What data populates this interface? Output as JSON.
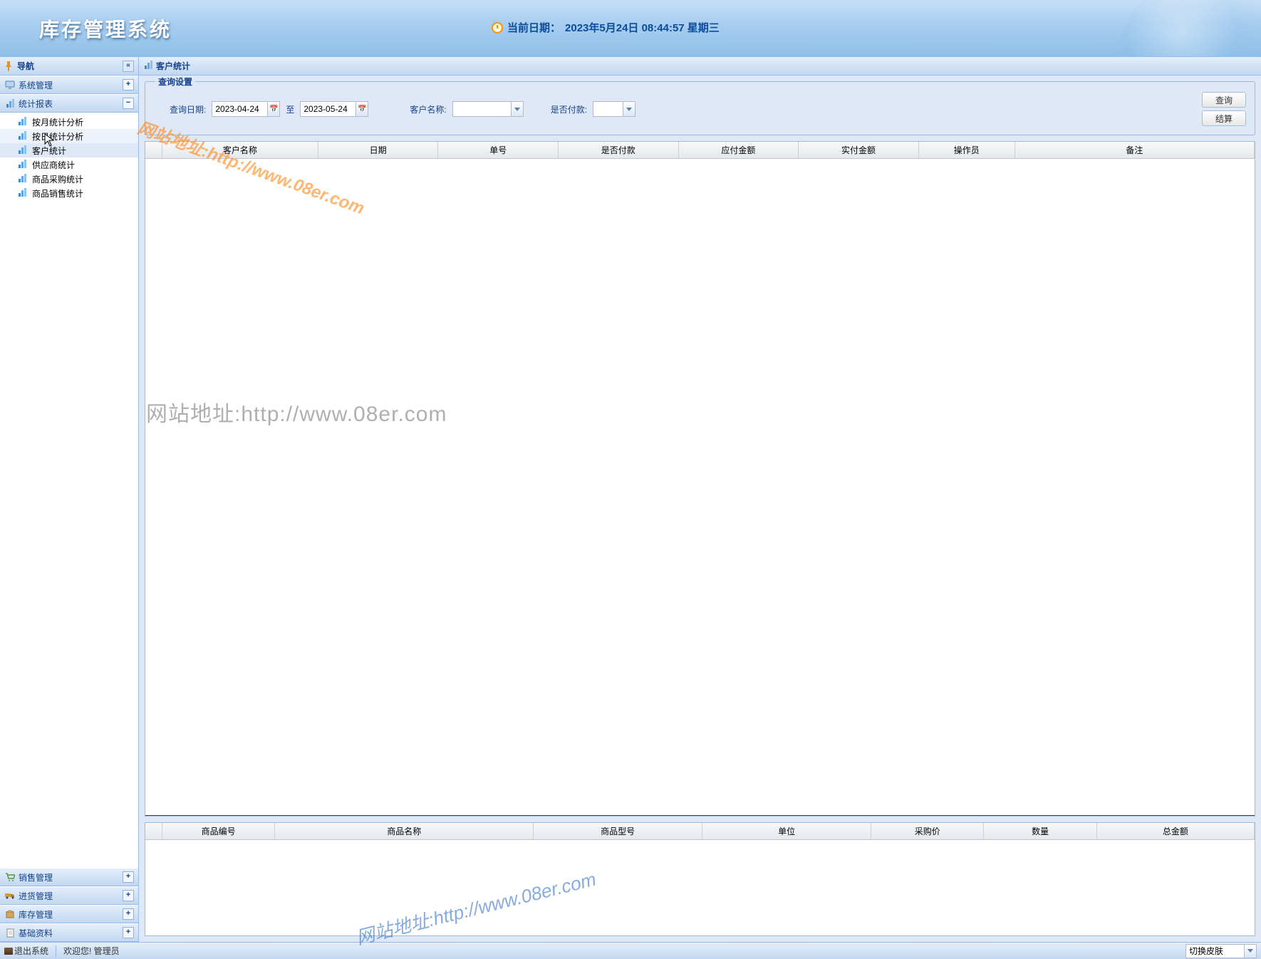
{
  "header": {
    "title": "库存管理系统",
    "date_label": "当前日期：",
    "date_value": "2023年5月24日 08:44:57 星期三"
  },
  "sidebar": {
    "nav_title": "导航",
    "sections": [
      {
        "label": "系统管理",
        "expanded": false,
        "icon": "monitor"
      },
      {
        "label": "统计报表",
        "expanded": true,
        "icon": "chart"
      },
      {
        "label": "销售管理",
        "expanded": false,
        "icon": "cart"
      },
      {
        "label": "进货管理",
        "expanded": false,
        "icon": "truck"
      },
      {
        "label": "库存管理",
        "expanded": false,
        "icon": "box"
      },
      {
        "label": "基础资料",
        "expanded": false,
        "icon": "doc"
      }
    ],
    "tree": [
      {
        "label": "按月统计分析"
      },
      {
        "label": "按日统计分析"
      },
      {
        "label": "客户统计"
      },
      {
        "label": "供应商统计"
      },
      {
        "label": "商品采购统计"
      },
      {
        "label": "商品销售统计"
      }
    ]
  },
  "tab": {
    "title": "客户统计"
  },
  "query": {
    "legend": "查询设置",
    "date_label": "查询日期:",
    "date_from": "2023-04-24",
    "date_to_label": "至",
    "date_to": "2023-05-24",
    "customer_label": "客户名称:",
    "customer_value": "",
    "paid_label": "是否付款:",
    "paid_value": "",
    "btn_query": "查询",
    "btn_settle": "结算"
  },
  "grid_main": {
    "cols": [
      "客户名称",
      "日期",
      "单号",
      "是否付款",
      "应付金额",
      "实付金额",
      "操作员",
      "备注"
    ]
  },
  "grid_sub": {
    "cols": [
      "商品编号",
      "商品名称",
      "商品型号",
      "单位",
      "采购价",
      "数量",
      "总金额"
    ]
  },
  "footer": {
    "exit": "退出系统",
    "welcome": "欢迎您! 管理员",
    "skin": "切换皮肤"
  },
  "watermarks": {
    "w1": "网站地址:http://www.08er.com",
    "w2": "网站地址:http://www.08er.com",
    "w3": "网站地址:http://www.08er.com"
  }
}
